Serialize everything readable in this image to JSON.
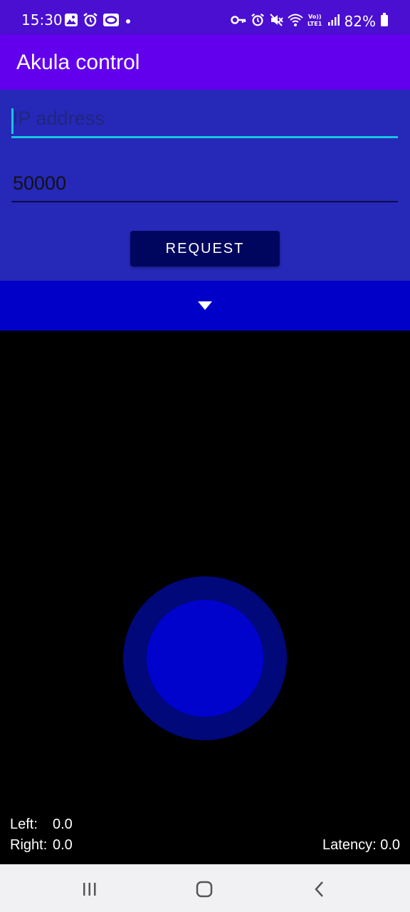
{
  "status_bar": {
    "time": "15:30",
    "battery": "82%",
    "left_icons": [
      "gallery-icon",
      "alarm-icon",
      "cast-icon",
      "dot-icon"
    ],
    "right_icons": [
      "vpn-key-icon",
      "alarm-icon",
      "mute-icon",
      "wifi-icon",
      "volte-icon",
      "signal-icon",
      "battery-icon"
    ]
  },
  "app_bar": {
    "title": "Akula control"
  },
  "form": {
    "ip_placeholder": "IP address",
    "ip_value": "",
    "port_value": "50000",
    "request_label": "REQUEST"
  },
  "joystick": {
    "left_label": "Left:",
    "left_value": "0.0",
    "right_label": "Right:",
    "right_value": "0.0",
    "latency_text": "Latency: 0.0"
  },
  "colors": {
    "status_bar": "#4a0fd0",
    "app_bar": "#6200ee",
    "form_panel": "#2628b8",
    "accent": "#19c4e0",
    "button": "#00065e",
    "collapse_bar": "#0000c8",
    "joystick_outer": "#00087a",
    "joystick_inner": "#0003cc"
  },
  "nav_bar": {
    "buttons": [
      "recent-apps-icon",
      "home-icon",
      "back-icon"
    ]
  }
}
